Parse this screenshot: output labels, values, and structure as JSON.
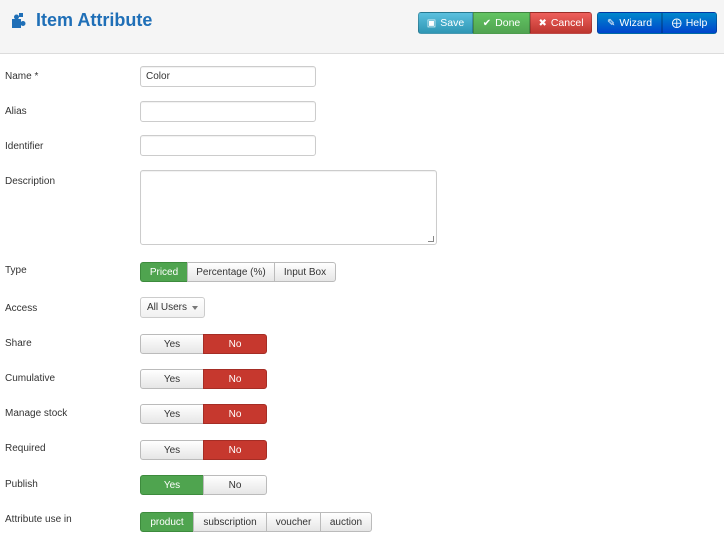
{
  "header": {
    "title": "Item Attribute",
    "icon": "puzzle-icon",
    "accent_color": "#1f6fb7"
  },
  "toolbar": {
    "save_label": "Save",
    "done_label": "Done",
    "cancel_label": "Cancel",
    "wizard_label": "Wizard",
    "help_label": "Help"
  },
  "form": {
    "name": {
      "label": "Name *",
      "value": "Color"
    },
    "alias": {
      "label": "Alias",
      "value": ""
    },
    "identifier": {
      "label": "Identifier",
      "value": ""
    },
    "description": {
      "label": "Description",
      "value": ""
    },
    "type": {
      "label": "Type",
      "options": [
        "Priced",
        "Percentage (%)",
        "Input Box"
      ],
      "selected": "Priced"
    },
    "access": {
      "label": "Access",
      "value": "All Users"
    },
    "share": {
      "label": "Share",
      "yes": "Yes",
      "no": "No",
      "selected": "No"
    },
    "cumulative": {
      "label": "Cumulative",
      "yes": "Yes",
      "no": "No",
      "selected": "No"
    },
    "manage_stock": {
      "label": "Manage stock",
      "yes": "Yes",
      "no": "No",
      "selected": "No"
    },
    "required": {
      "label": "Required",
      "yes": "Yes",
      "no": "No",
      "selected": "No"
    },
    "publish": {
      "label": "Publish",
      "yes": "Yes",
      "no": "No",
      "selected": "Yes"
    },
    "use_in": {
      "label": "Attribute use in",
      "options": [
        "product",
        "subscription",
        "voucher",
        "auction"
      ],
      "selected": "product"
    }
  },
  "colors": {
    "active_green": "#4fa44f",
    "active_red": "#c6382e"
  }
}
